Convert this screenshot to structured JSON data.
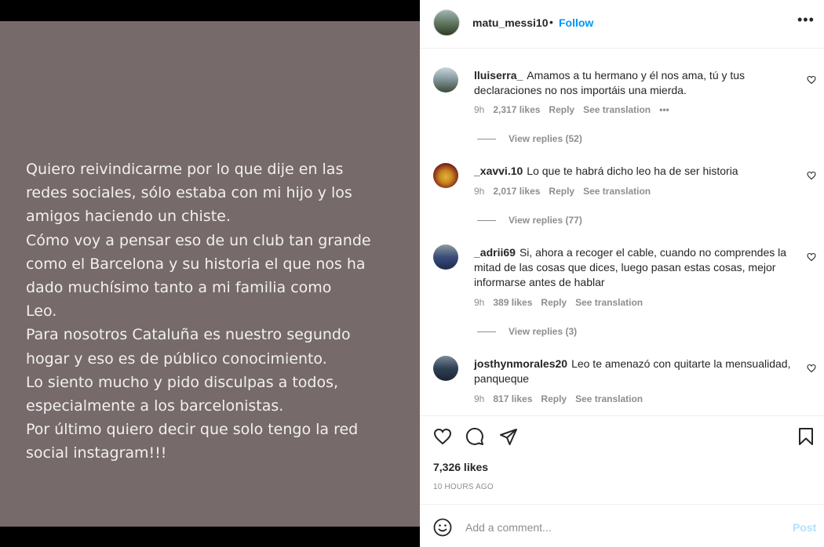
{
  "story": {
    "lines": [
      "Quiero reivindicarme por lo que dije en las",
      "redes sociales, sólo estaba con mi hijo y los",
      "amigos haciendo un chiste.",
      "Cómo voy a pensar eso de un club tan grande",
      "como el Barcelona y su historia el que nos ha",
      "dado muchísimo tanto a mi familia como",
      "Leo.",
      "Para nosotros Cataluña es nuestro segundo",
      "hogar y eso es de público conocimiento.",
      "Lo siento mucho y pido disculpas a todos,",
      "especialmente a los barcelonistas.",
      "Por último quiero decir que solo tengo la red",
      "social instagram!!!"
    ]
  },
  "header": {
    "username": "matu_messi10",
    "separator": "•",
    "follow": "Follow",
    "more": "•••"
  },
  "comments": [
    {
      "username": "lluiserra_",
      "text": "Amamos a tu hermano y él nos ama, tú y tus declaraciones no nos importáis una mierda.",
      "time": "9h",
      "likes": "2,317 likes",
      "reply": "Reply",
      "translate": "See translation",
      "more": "•••",
      "view_replies": "View replies (52)"
    },
    {
      "username": "_xavvi.10",
      "text": "Lo que te habrá dicho leo ha de ser historia",
      "time": "9h",
      "likes": "2,017 likes",
      "reply": "Reply",
      "translate": "See translation",
      "view_replies": "View replies (77)"
    },
    {
      "username": "_adrii69",
      "text": "Si, ahora a recoger el cable, cuando no comprendes la mitad de las cosas que dices, luego pasan estas cosas, mejor informarse antes de hablar",
      "time": "9h",
      "likes": "389 likes",
      "reply": "Reply",
      "translate": "See translation",
      "view_replies": "View replies (3)"
    },
    {
      "username": "josthynmorales20",
      "text": "Leo te amenazó con quitarte la mensualidad, panqueque",
      "time": "9h",
      "likes": "817 likes",
      "reply": "Reply",
      "translate": "See translation"
    }
  ],
  "actions": {
    "icons": [
      "heart-icon",
      "comment-icon",
      "share-icon",
      "bookmark-icon"
    ]
  },
  "post": {
    "likes": "7,326 likes",
    "time": "10 HOURS AGO"
  },
  "comment_box": {
    "placeholder": "Add a comment...",
    "post": "Post"
  },
  "colors": {
    "story_background": "#766a6b",
    "link_blue": "#0095f6",
    "post_disabled": "#b2dffc",
    "meta_gray": "#8e8e8e"
  }
}
